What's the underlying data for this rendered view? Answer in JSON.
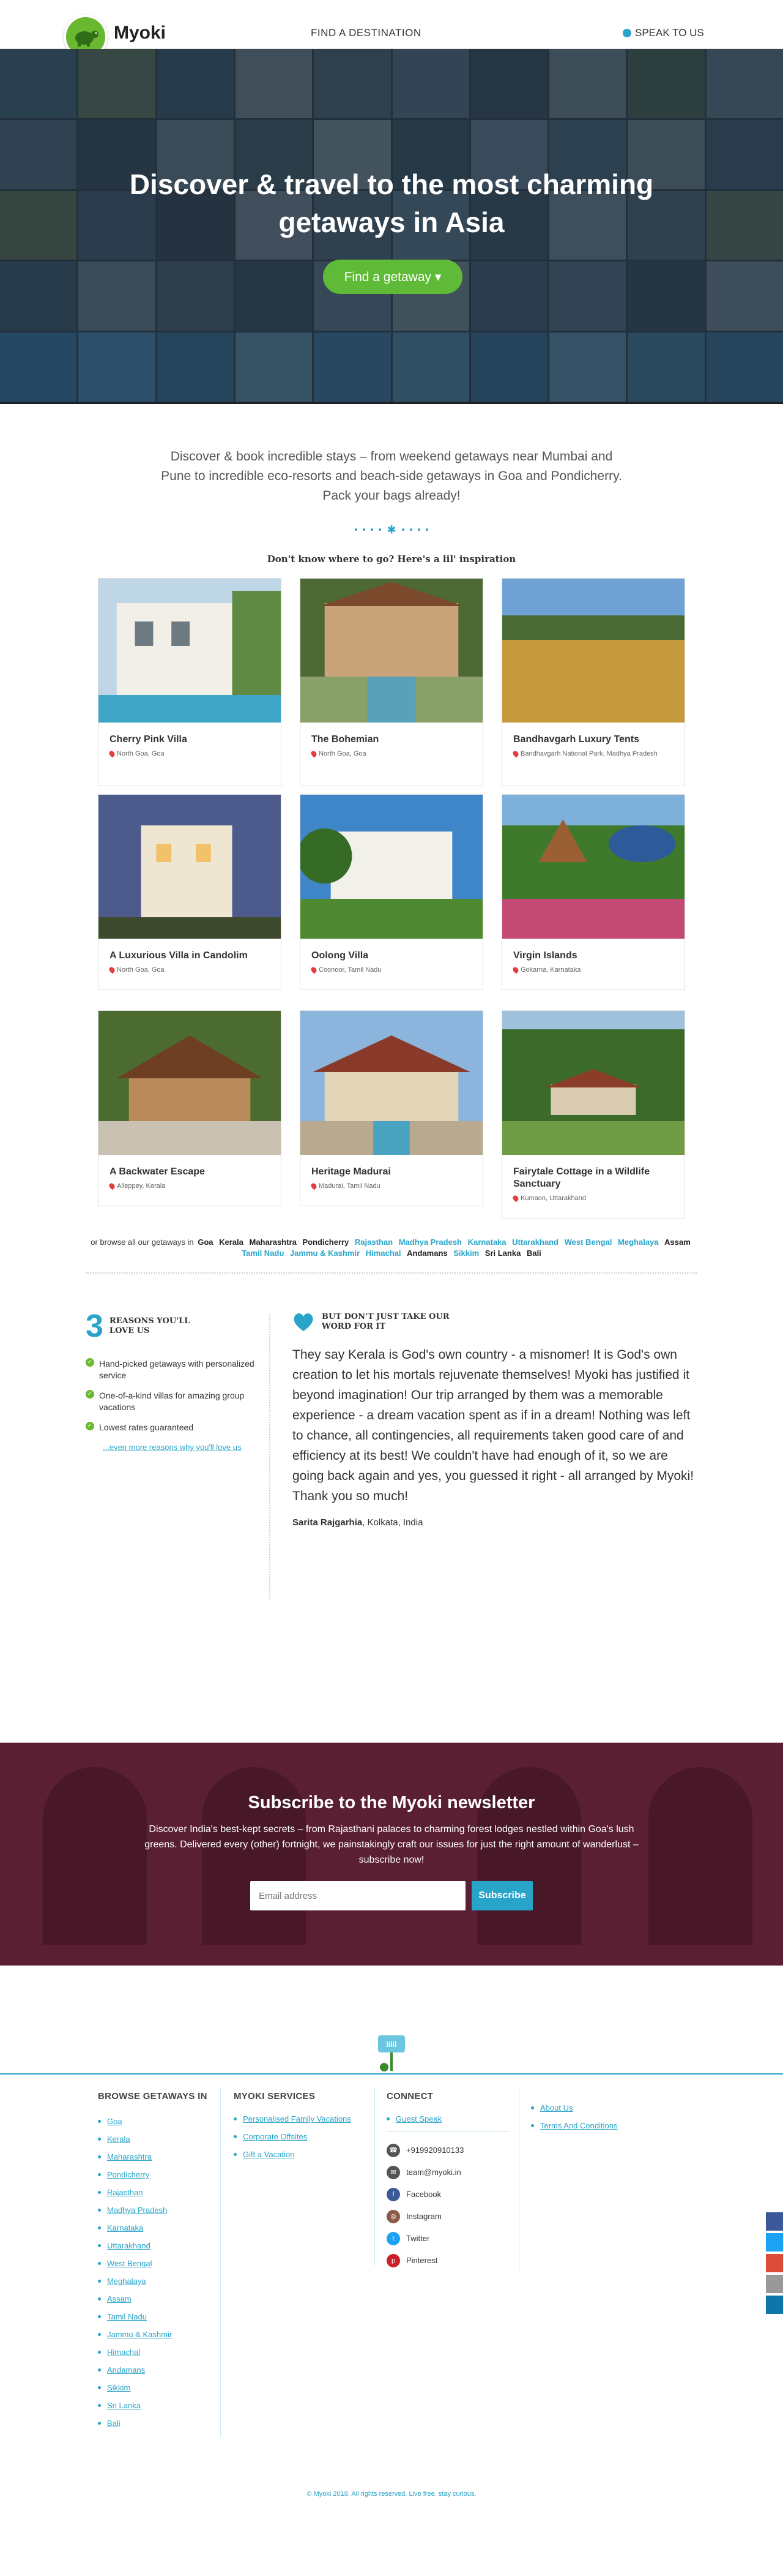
{
  "header": {
    "logo_text": "Myoki",
    "nav_destination": "FIND A DESTINATION",
    "nav_speak": "SPEAK TO US"
  },
  "hero": {
    "title_line1": "Discover & travel to the most charming",
    "title_line2": "getaways in Asia",
    "cta": "Find a getaway ▾"
  },
  "intro": {
    "text": "Discover & book incredible stays – from weekend getaways near Mumbai and Pune to incredible eco-resorts and beach-side getaways in Goa and Pondicherry. Pack your bags already!",
    "inspiration": "Don't know where to go? Here's a lil' inspiration"
  },
  "stays": [
    {
      "name": "Cherry Pink Villa",
      "location": "North Goa, Goa"
    },
    {
      "name": "The Bohemian",
      "location": "North Goa, Goa"
    },
    {
      "name": "Bandhavgarh Luxury Tents",
      "location": "Bandhavgarh National Park, Madhya Pradesh"
    },
    {
      "name": "A Luxurious Villa in Candolim",
      "location": "North Goa, Goa"
    },
    {
      "name": "Oolong Villa",
      "location": "Coonoor, Tamil Nadu"
    },
    {
      "name": "Virgin Islands",
      "location": "Gokarna, Karnataka"
    },
    {
      "name": "A Backwater Escape",
      "location": "Alleppey, Kerala"
    },
    {
      "name": "Heritage Madurai",
      "location": "Madurai, Tamil Nadu"
    },
    {
      "name": "Fairytale Cottage in a Wildlife Sanctuary",
      "location": "Kumaon, Uttarakhand"
    }
  ],
  "browse": {
    "prefix": "or browse all our getaways in",
    "places": [
      "Goa",
      "Kerala",
      "Maharashtra",
      "Pondicherry",
      "Rajasthan",
      "Madhya Pradesh",
      "Karnataka",
      "Uttarakhand",
      "West Bengal",
      "Meghalaya",
      "Assam",
      "Tamil Nadu",
      "Jammu & Kashmir",
      "Himachal",
      "Andamans",
      "Sikkim",
      "Sri Lanka",
      "Bali"
    ]
  },
  "reasons": {
    "number": "3",
    "title_line1": "REASONS YOU'LL",
    "title_line2": "LOVE US",
    "items": [
      "Hand-picked getaways with personalized service",
      "One-of-a-kind villas for amazing group vacations",
      "Lowest rates guaranteed"
    ],
    "more": "...even more reasons why you'll love us"
  },
  "testimonial": {
    "title_line1": "BUT DON'T JUST TAKE OUR",
    "title_line2": "WORD FOR IT",
    "quote": "They say Kerala is God's own country - a misnomer! It is God's own creation to let his mortals rejuvenate themselves! Myoki has justified it beyond imagination! Our trip arranged by them was a memorable experience - a dream vacation spent as if in a dream! Nothing was left to chance, all contingencies, all requirements taken good care of and efficiency at its best! We couldn't have had enough of it, so we are going back again and yes, you guessed it right - all arranged by Myoki! Thank you so much!",
    "author": "Sarita Rajgarhia",
    "author_place": ", Kolkata, India"
  },
  "newsletter": {
    "title": "Subscribe to the Myoki newsletter",
    "text": "Discover India's best-kept secrets – from Rajasthani palaces to charming forest lodges nestled within Goa's lush greens. Delivered every (other) fortnight, we painstakingly craft our issues for just the right amount of wanderlust – subscribe now!",
    "placeholder": "Email address",
    "button": "Subscribe"
  },
  "footer": {
    "browse_title": "BROWSE GETAWAYS IN",
    "browse_items": [
      "Goa",
      "Kerala",
      "Maharashtra",
      "Pondicherry",
      "Rajasthan",
      "Madhya Pradesh",
      "Karnataka",
      "Uttarakhand",
      "West Bengal",
      "Meghalaya",
      "Assam",
      "Tamil Nadu",
      "Jammu & Kashmir",
      "Himachal",
      "Andamans",
      "Sikkim",
      "Sri Lanka",
      "Bali"
    ],
    "services_title": "MYOKI SERVICES",
    "services_items": [
      "Personalised Family Vacations",
      "Corporate Offsites",
      "Gift a Vacation"
    ],
    "connect_title": "CONNECT",
    "connect_link": "Guest Speak",
    "phone": "+919920910133",
    "email": "team@myoki.in",
    "facebook": "Facebook",
    "instagram": "Instagram",
    "twitter": "Twitter",
    "pinterest": "Pinterest",
    "about": "About Us",
    "terms": "Terms And Conditions",
    "hut_sign": "lilil",
    "copyright": "© Myoki 2018. All rights reserved. Live free, stay curious."
  },
  "colors": {
    "brand_green": "#6ab830",
    "accent_blue": "#28a4c9",
    "newsletter_bg": "#5a1f33"
  }
}
